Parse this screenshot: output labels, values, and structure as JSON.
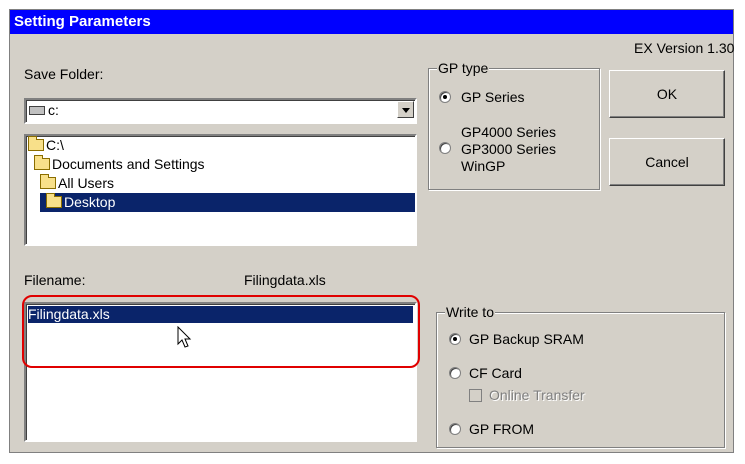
{
  "window": {
    "title": "Setting Parameters",
    "version": "EX Version 1.30"
  },
  "save_folder": {
    "label": "Save Folder:",
    "drive": "c:",
    "tree": [
      {
        "label": "C:\\",
        "icon": "drive-folder-icon",
        "selected": false
      },
      {
        "label": "Documents and Settings",
        "icon": "folder-icon",
        "selected": false
      },
      {
        "label": "All Users",
        "icon": "folder-icon",
        "selected": false
      },
      {
        "label": "Desktop",
        "icon": "folder-open-icon",
        "selected": true
      }
    ]
  },
  "filename": {
    "label": "Filename:",
    "value": "Filingdata.xls",
    "list": [
      "Filingdata.xls"
    ]
  },
  "gp_type": {
    "title": "GP type",
    "options": [
      {
        "label": "GP Series",
        "selected": true
      },
      {
        "line1": "GP4000 Series",
        "line2": "GP3000 Series",
        "line3": "WinGP",
        "selected": false
      }
    ]
  },
  "buttons": {
    "ok": "OK",
    "cancel": "Cancel"
  },
  "write_to": {
    "title": "Write to",
    "options": [
      {
        "label": "GP Backup SRAM",
        "selected": true
      },
      {
        "label": "CF Card",
        "selected": false
      },
      {
        "label": "GP FROM",
        "selected": false
      }
    ],
    "online_transfer": {
      "label": "Online Transfer",
      "checked": false,
      "enabled": false
    }
  },
  "colors": {
    "title_bar": "#0000ff",
    "selection": "#0a246a",
    "highlight_box": "#e00000",
    "face": "#d4d0c8"
  }
}
